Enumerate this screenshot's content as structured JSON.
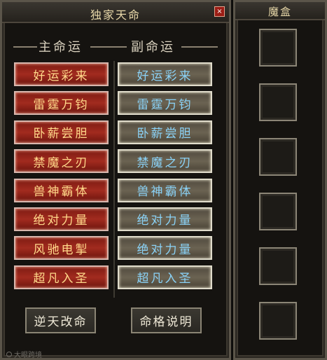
{
  "window": {
    "title": "独家天命",
    "close_label": "×"
  },
  "headers": {
    "main": "主命运",
    "secondary": "副命运"
  },
  "main_fate": [
    "好运彩来",
    "雷霆万钧",
    "卧薪尝胆",
    "禁魔之刃",
    "兽神霸体",
    "绝对力量",
    "风驰电掣",
    "超凡入圣"
  ],
  "secondary_fate": [
    "好运彩来",
    "雷霆万钧",
    "卧薪尝胆",
    "禁魔之刃",
    "兽神霸体",
    "绝对力量",
    "绝对力量",
    "超凡入圣"
  ],
  "actions": {
    "reroll": "逆天改命",
    "help": "命格说明"
  },
  "watermark": "大眼跨境",
  "magic_box": {
    "title": "魔盒",
    "slots": 6
  },
  "colors": {
    "main_button": "#a22b1f",
    "secondary_button": "#6b6352",
    "title_text": "#e7d7a8",
    "secondary_text": "#8ad2f7"
  }
}
